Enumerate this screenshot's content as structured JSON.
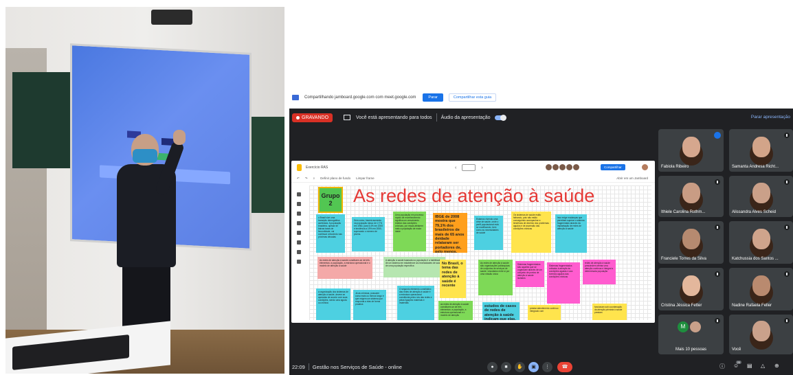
{
  "share_bar": {
    "text": "Compartilhando jamboard.google.com com meet.google.com",
    "stop": "Parar",
    "share_tab": "Compartilhar esta guia"
  },
  "meet_top": {
    "recording": "GRAVANDO",
    "presenting": "Você está apresentando para todos",
    "audio": "Áudio da apresentação",
    "audio_on": true,
    "stop_presenting": "Parar apresentação"
  },
  "jamboard": {
    "doc_title": "Exercício RAS",
    "share_button": "Compartilhar",
    "toolbar": [
      "Definir plano de fundo",
      "Limpar frame"
    ],
    "open_in": "Abrir em um Jamboard",
    "group_label": "Grupo 2",
    "board_title": "As redes de atenção à saúde",
    "notes": [
      {
        "text": "o Brasil vive uma transição demográfica acelerada. A população brasileira, apesar de baixas taxas de fecundidade, vai continuar crescendo nas próximas décadas",
        "color": "#4dd0e1",
        "bold": false
      },
      {
        "text": "Sem como, haverá aumento na população idosa: de 2,7% em 1960, para 5,4% em 2000 e tendência a 19% em 2050, superando o número de jovens.",
        "color": "#4dd0e1",
        "bold": false
      },
      {
        "text": "Uma população em processo rápido de envelhecimento significa um crescimento relativo das condições crônicas, por essas afetarem mais a população de maior idade",
        "color": "#7ed957",
        "bold": false
      },
      {
        "text": "IBGE de 2008 mostra que 79,1% dos brasileiros de mais de 65 anos deidade relataram ser portadores de, pelo menos, uma doença crônica",
        "color": "#ff9f1c",
        "bold": true
      },
      {
        "text": "Estamos vivendo uma crise de saúde, onde o perfil populacional está se modificando, bem como as necessidades de saúde",
        "color": "#4dd0e1",
        "bold": false
      },
      {
        "text": "Os sistemas de saúde estão falhando, pois não estão conseguindo acompanhar a tendência de declínio dos problemas agudos e de ascensão das condições crônicas",
        "color": "#ffe44d",
        "bold": false
      },
      {
        "text": "Isso exige mudanças que permitam superar o sistema fragmentado através da implantação de redes de atenção à saúde",
        "color": "#4dd0e1",
        "bold": false
      },
      {
        "text": "As redes de atenção à saúde constituem-se de três elementos: a população, a estrutura operacional e o modelo de atenção à saúde",
        "color": "#f4a9a8",
        "bold": false
      },
      {
        "text": "A atenção à saúde baseada na população é a habilidade de um sistema em estabelecer as necessidades de saúde de uma população específica",
        "color": "#b6e6b0",
        "bold": false
      },
      {
        "text": "No Brasil, o tema das redes de atenção à saúde é recente",
        "color": "#ffe44d",
        "bold": true
      },
      {
        "text": "As redes de atenção à saúde são organizações poliárquicas de conjuntos de serviços de saúde, vinculados entre si por uma missão única",
        "color": "#7ed957",
        "bold": false
      },
      {
        "text": "Sistemas fragmentados são aqueles que se organizam através de um conjunto de pontos de atenção à saúde isolados",
        "color": "#ff5ccf",
        "bold": false
      },
      {
        "text": "Sistemas fragmentados voltados à atenção às condições agudas e aos eventos agudos das condições crônicas",
        "color": "#ff5ccf",
        "bold": false
      },
      {
        "text": "redes de atenção à saúde prescindem ofertar uma atenção contínua e integral a determinada população",
        "color": "#ff5ccf",
        "bold": false
      },
      {
        "text": "a organização dos sistemas de atenção à saúde, devem se apoiadas de acordo com suas condições, sendo uma aguda ou crônica",
        "color": "#4dd0e1",
        "bold": false
      },
      {
        "text": "Já as crônicas, possuem curso mais ou menos longo e que exigem um sistema que responda a elas de forma proativa",
        "color": "#4dd0e1",
        "bold": false
      },
      {
        "text": "O segundo elemento constitutivo das redes de atenção à saúde é a estrutura operacional constituída pelos nós das redes e pelas ligações materiais e imateriais",
        "color": "#4dd0e1",
        "bold": false
      },
      {
        "text": "as redes de atenção à saúde constituem-se de três elementos: a população, a estrutura operacional e o modelo de atenção",
        "color": "#7ed957",
        "bold": false
      },
      {
        "text": "estudos de casos de redes de atenção à saúde indicam que elas, à semelhança do",
        "color": "#4dd0e1",
        "bold": true
      },
      {
        "text": "prestar atendimento contínuo integrado com",
        "color": "#ffe44d",
        "bold": false
      },
      {
        "text": "funcionam sob coordenação da atenção primária à saúde prestam",
        "color": "#ffe44d",
        "bold": false
      }
    ]
  },
  "participants": [
    {
      "name": "Fabiola Ribeiro",
      "speaking": true
    },
    {
      "name": "Samanta Andresa Richt..."
    },
    {
      "name": "Ithiele Carolina Rothm..."
    },
    {
      "name": "Alissandra Alves Scheid"
    },
    {
      "name": "Franciele Torres da Silva"
    },
    {
      "name": "Katchussia dos Santos ..."
    },
    {
      "name": "Cristina Jéssica Fetter"
    },
    {
      "name": "Nadine Rafaela Feller"
    },
    {
      "name": "Mais 10 pessoas",
      "avatar_letter": "M"
    },
    {
      "name": "Você"
    }
  ],
  "bottom": {
    "time": "22:09",
    "meeting_title": "Gestão nos Serviços de Saúde - online",
    "people_count": "20"
  },
  "colors": {
    "meet_bg": "#202124",
    "record_red": "#d93025",
    "title_red": "#e53935",
    "link_blue": "#8ab4f8"
  }
}
